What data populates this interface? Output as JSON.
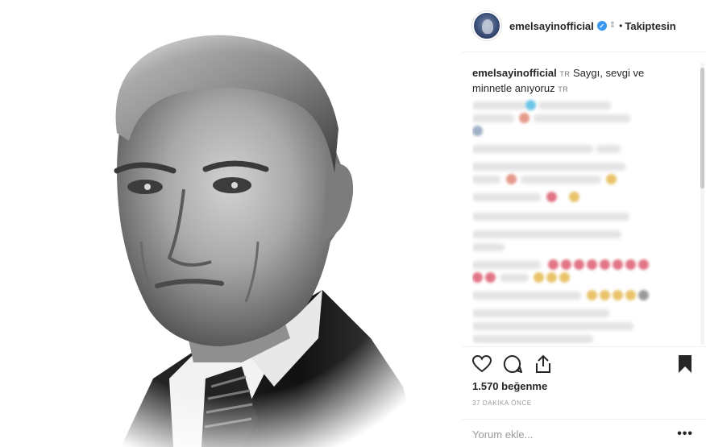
{
  "post": {
    "username": "emelsayinofficial",
    "follow_status": "Takiptesin",
    "caption_text": "Saygı, sevgi ve minnetle anıyoruz",
    "flag_label": "TR",
    "likes": "1.570 beğenme",
    "time_ago": "37 DAKİKA ÖNCE",
    "comment_placeholder": "Yorum ekle...",
    "more_label": "•••",
    "dot": "•"
  },
  "icons": {
    "like": "heart-outline-icon",
    "comment": "speech-bubble-icon",
    "share": "share-icon",
    "save": "bookmark-filled-icon",
    "verified": "verified-badge-icon"
  },
  "colors": {
    "verified": "#3897f0",
    "text": "#262626",
    "muted": "#999999"
  }
}
